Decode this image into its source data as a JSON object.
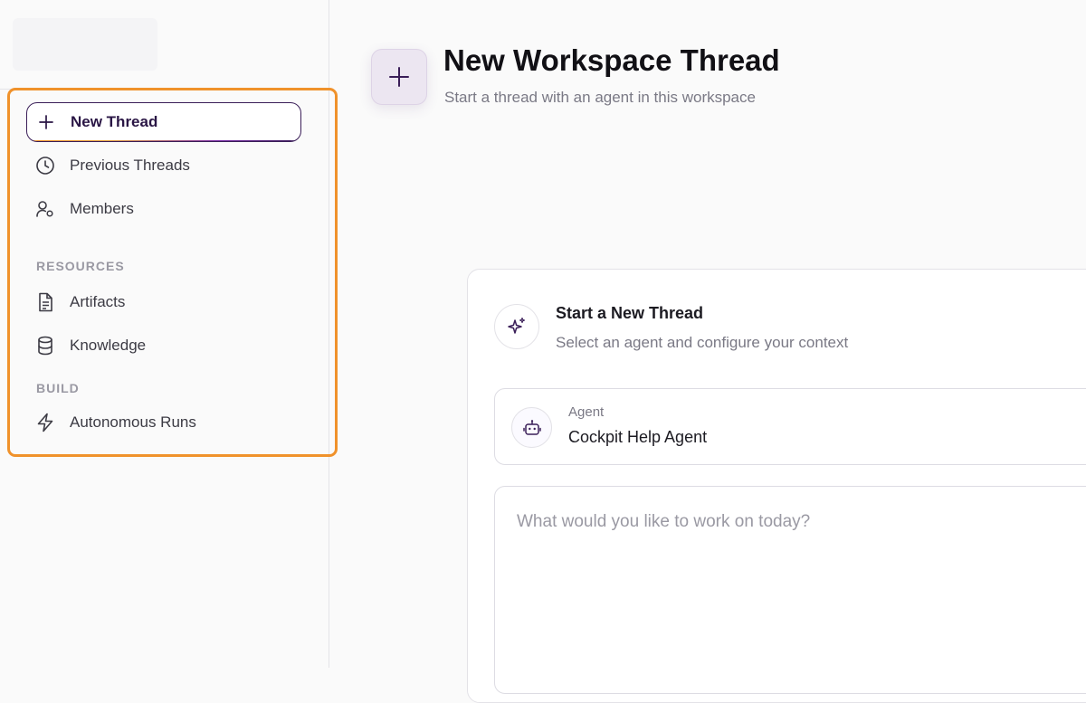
{
  "sidebar": {
    "nav": [
      {
        "label": "New Thread",
        "icon": "plus-icon",
        "active": true
      },
      {
        "label": "Previous Threads",
        "icon": "clock-icon"
      },
      {
        "label": "Members",
        "icon": "user-settings-icon"
      }
    ],
    "resources_label": "RESOURCES",
    "resources": [
      {
        "label": "Artifacts",
        "icon": "file-text-icon"
      },
      {
        "label": "Knowledge",
        "icon": "database-icon"
      }
    ],
    "build_label": "BUILD",
    "build": [
      {
        "label": "Autonomous Runs",
        "icon": "lightning-icon"
      }
    ]
  },
  "header": {
    "title": "New Workspace Thread",
    "subtitle": "Start a thread with an agent in this workspace"
  },
  "card": {
    "title": "Start a New Thread",
    "subtitle": "Select an agent and configure your context",
    "agent_label": "Agent",
    "agent_value": "Cockpit Help Agent",
    "prompt_placeholder": "What would you like to work on today?"
  },
  "colors": {
    "highlight": "#f0922b",
    "accent": "#3a1e58",
    "accent_bg": "#ece6f1"
  }
}
